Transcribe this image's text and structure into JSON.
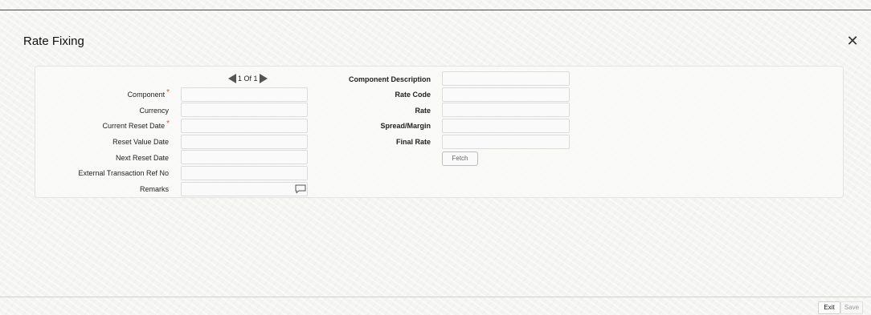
{
  "title": "Rate Fixing",
  "close_icon": "close-icon",
  "pager": {
    "text": "1 Of 1"
  },
  "left_fields": [
    {
      "label": "Component",
      "required": true,
      "value": ""
    },
    {
      "label": "Currency",
      "required": false,
      "value": ""
    },
    {
      "label": "Current Reset Date",
      "required": true,
      "value": ""
    },
    {
      "label": "Reset Value Date",
      "required": false,
      "value": ""
    },
    {
      "label": "Next Reset Date",
      "required": false,
      "value": ""
    },
    {
      "label": "External Transaction Ref No",
      "required": false,
      "value": ""
    },
    {
      "label": "Remarks",
      "required": false,
      "value": ""
    }
  ],
  "right_fields": [
    {
      "label": "Component Description",
      "value": ""
    },
    {
      "label": "Rate Code",
      "value": ""
    },
    {
      "label": "Rate",
      "value": ""
    },
    {
      "label": "Spread/Margin",
      "value": ""
    },
    {
      "label": "Final Rate",
      "value": ""
    }
  ],
  "fetch_label": "Fetch",
  "footer": {
    "exit_label": "Exit",
    "save_label": "Save"
  },
  "required_marker": "*",
  "colors": {
    "required": "#d9534f",
    "rule": "#4a4a4a"
  }
}
